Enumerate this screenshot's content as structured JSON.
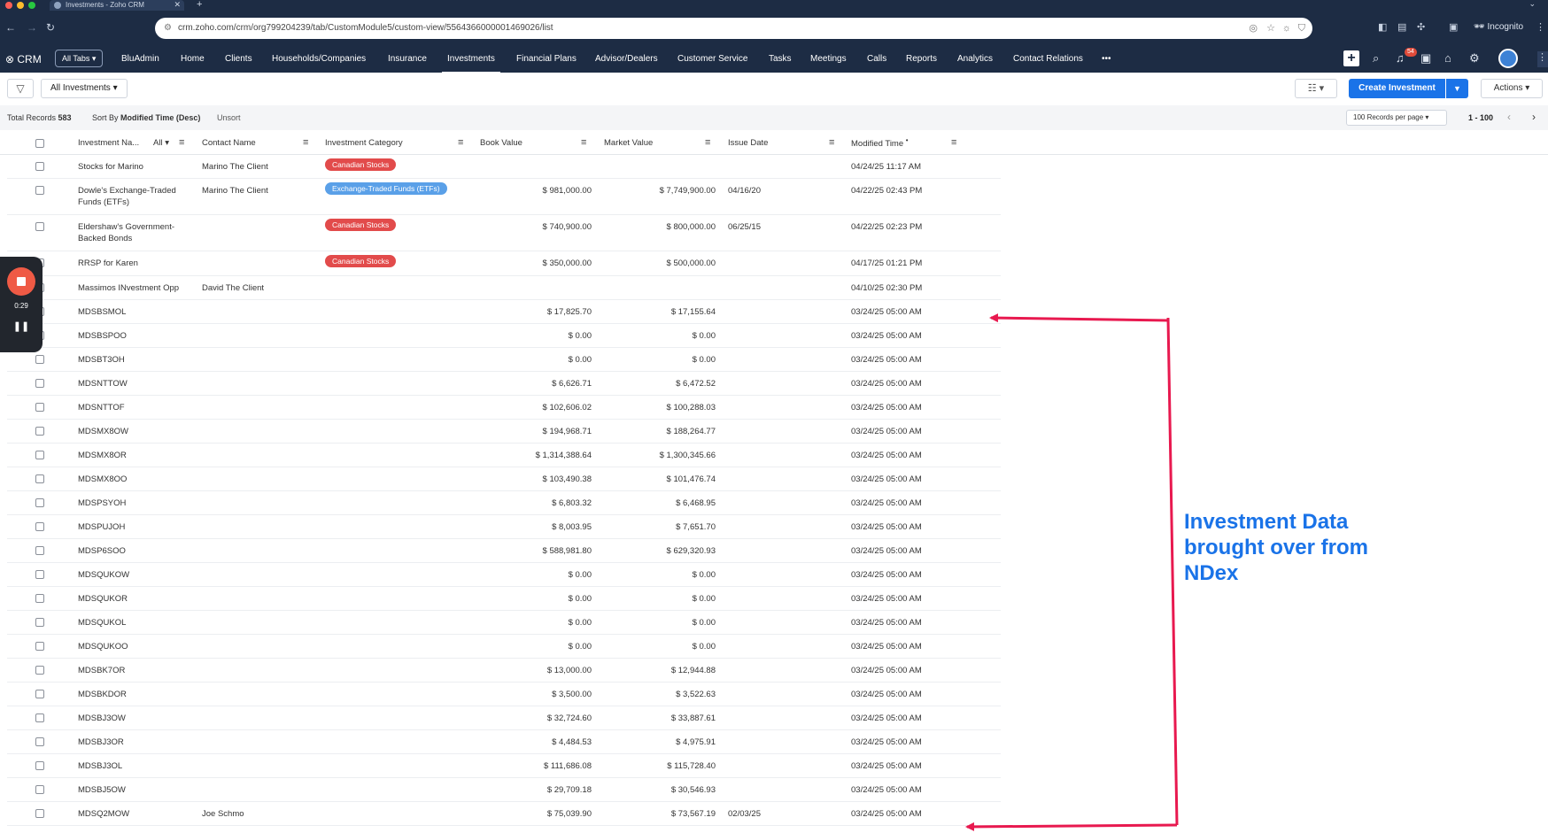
{
  "browser": {
    "tab_title": "Investments - Zoho CRM",
    "url": "crm.zoho.com/crm/org799204239/tab/CustomModule5/custom-view/5564366000001469026/list",
    "incognito_label": "Incognito"
  },
  "crm_nav": {
    "logo": "CRM",
    "all_tabs": "All Tabs",
    "items": [
      "BluAdmin",
      "Home",
      "Clients",
      "Households/Companies",
      "Insurance",
      "Investments",
      "Financial Plans",
      "Advisor/Dealers",
      "Customer Service",
      "Tasks",
      "Meetings",
      "Calls",
      "Reports",
      "Analytics",
      "Contact Relations"
    ],
    "active": "Investments",
    "more": "•••",
    "notification_count": "54"
  },
  "toolbar": {
    "view_name": "All Investments",
    "create_label": "Create Investment",
    "actions_label": "Actions"
  },
  "infobar": {
    "total_label": "Total Records",
    "total_value": "583",
    "sort_label": "Sort By",
    "sort_value": "Modified Time (Desc)",
    "unsort": "Unsort",
    "per_page": "100 Records per page",
    "range": "1 - 100"
  },
  "table": {
    "columns": [
      "Investment Na...",
      "Contact Name",
      "Investment Category",
      "Book Value",
      "Market Value",
      "Issue Date",
      "Modified Time"
    ],
    "name_filter": "All",
    "rows": [
      {
        "name": "Stocks for Marino",
        "contact": "Marino The Client",
        "category": "Canadian Stocks",
        "book": "",
        "market": "",
        "issue": "",
        "modified": "04/24/25 11:17 AM"
      },
      {
        "name": "Dowle's Exchange-Traded Funds (ETFs)",
        "contact": "Marino The Client",
        "category": "Exchange-Traded Funds (ETFs)",
        "book": "$ 981,000.00",
        "market": "$ 7,749,900.00",
        "issue": "04/16/20",
        "modified": "04/22/25 02:43 PM"
      },
      {
        "name": "Eldershaw's Government-Backed Bonds",
        "contact": "",
        "category": "Canadian Stocks",
        "book": "$ 740,900.00",
        "market": "$ 800,000.00",
        "issue": "06/25/15",
        "modified": "04/22/25 02:23 PM"
      },
      {
        "name": "RRSP for Karen",
        "contact": "",
        "category": "Canadian Stocks",
        "book": "$ 350,000.00",
        "market": "$ 500,000.00",
        "issue": "",
        "modified": "04/17/25 01:21 PM"
      },
      {
        "name": "Massimos INvestment Opp",
        "contact": "David The Client",
        "category": "",
        "book": "",
        "market": "",
        "issue": "",
        "modified": "04/10/25 02:30 PM"
      },
      {
        "name": "MDSBSMOL",
        "contact": "",
        "category": "",
        "book": "$ 17,825.70",
        "market": "$ 17,155.64",
        "issue": "",
        "modified": "03/24/25 05:00 AM"
      },
      {
        "name": "MDSBSPOO",
        "contact": "",
        "category": "",
        "book": "$ 0.00",
        "market": "$ 0.00",
        "issue": "",
        "modified": "03/24/25 05:00 AM"
      },
      {
        "name": "MDSBT3OH",
        "contact": "",
        "category": "",
        "book": "$ 0.00",
        "market": "$ 0.00",
        "issue": "",
        "modified": "03/24/25 05:00 AM"
      },
      {
        "name": "MDSNTTOW",
        "contact": "",
        "category": "",
        "book": "$ 6,626.71",
        "market": "$ 6,472.52",
        "issue": "",
        "modified": "03/24/25 05:00 AM"
      },
      {
        "name": "MDSNTTOF",
        "contact": "",
        "category": "",
        "book": "$ 102,606.02",
        "market": "$ 100,288.03",
        "issue": "",
        "modified": "03/24/25 05:00 AM"
      },
      {
        "name": "MDSMX8OW",
        "contact": "",
        "category": "",
        "book": "$ 194,968.71",
        "market": "$ 188,264.77",
        "issue": "",
        "modified": "03/24/25 05:00 AM"
      },
      {
        "name": "MDSMX8OR",
        "contact": "",
        "category": "",
        "book": "$ 1,314,388.64",
        "market": "$ 1,300,345.66",
        "issue": "",
        "modified": "03/24/25 05:00 AM"
      },
      {
        "name": "MDSMX8OO",
        "contact": "",
        "category": "",
        "book": "$ 103,490.38",
        "market": "$ 101,476.74",
        "issue": "",
        "modified": "03/24/25 05:00 AM"
      },
      {
        "name": "MDSPSYOH",
        "contact": "",
        "category": "",
        "book": "$ 6,803.32",
        "market": "$ 6,468.95",
        "issue": "",
        "modified": "03/24/25 05:00 AM"
      },
      {
        "name": "MDSPUJOH",
        "contact": "",
        "category": "",
        "book": "$ 8,003.95",
        "market": "$ 7,651.70",
        "issue": "",
        "modified": "03/24/25 05:00 AM"
      },
      {
        "name": "MDSP6SOO",
        "contact": "",
        "category": "",
        "book": "$ 588,981.80",
        "market": "$ 629,320.93",
        "issue": "",
        "modified": "03/24/25 05:00 AM"
      },
      {
        "name": "MDSQUKOW",
        "contact": "",
        "category": "",
        "book": "$ 0.00",
        "market": "$ 0.00",
        "issue": "",
        "modified": "03/24/25 05:00 AM"
      },
      {
        "name": "MDSQUKOR",
        "contact": "",
        "category": "",
        "book": "$ 0.00",
        "market": "$ 0.00",
        "issue": "",
        "modified": "03/24/25 05:00 AM"
      },
      {
        "name": "MDSQUKOL",
        "contact": "",
        "category": "",
        "book": "$ 0.00",
        "market": "$ 0.00",
        "issue": "",
        "modified": "03/24/25 05:00 AM"
      },
      {
        "name": "MDSQUKOO",
        "contact": "",
        "category": "",
        "book": "$ 0.00",
        "market": "$ 0.00",
        "issue": "",
        "modified": "03/24/25 05:00 AM"
      },
      {
        "name": "MDSBK7OR",
        "contact": "",
        "category": "",
        "book": "$ 13,000.00",
        "market": "$ 12,944.88",
        "issue": "",
        "modified": "03/24/25 05:00 AM"
      },
      {
        "name": "MDSBKDOR",
        "contact": "",
        "category": "",
        "book": "$ 3,500.00",
        "market": "$ 3,522.63",
        "issue": "",
        "modified": "03/24/25 05:00 AM"
      },
      {
        "name": "MDSBJ3OW",
        "contact": "",
        "category": "",
        "book": "$ 32,724.60",
        "market": "$ 33,887.61",
        "issue": "",
        "modified": "03/24/25 05:00 AM"
      },
      {
        "name": "MDSBJ3OR",
        "contact": "",
        "category": "",
        "book": "$ 4,484.53",
        "market": "$ 4,975.91",
        "issue": "",
        "modified": "03/24/25 05:00 AM"
      },
      {
        "name": "MDSBJ3OL",
        "contact": "",
        "category": "",
        "book": "$ 111,686.08",
        "market": "$ 115,728.40",
        "issue": "",
        "modified": "03/24/25 05:00 AM"
      },
      {
        "name": "MDSBJ5OW",
        "contact": "",
        "category": "",
        "book": "$ 29,709.18",
        "market": "$ 30,546.93",
        "issue": "",
        "modified": "03/24/25 05:00 AM"
      },
      {
        "name": "MDSQ2MOW",
        "contact": "Joe Schmo",
        "category": "",
        "book": "$ 75,039.90",
        "market": "$ 73,567.19",
        "issue": "02/03/25",
        "modified": "03/24/25 05:00 AM"
      }
    ]
  },
  "category_colors": {
    "Canadian Stocks": "#e24b4b",
    "Exchange-Traded Funds (ETFs)": "#5aa0e8"
  },
  "recorder": {
    "time": "0:29"
  },
  "annotation": {
    "text": "Investment Data brought over from NDex",
    "color": "#1a73e8",
    "arrow_color": "#e8194f"
  }
}
